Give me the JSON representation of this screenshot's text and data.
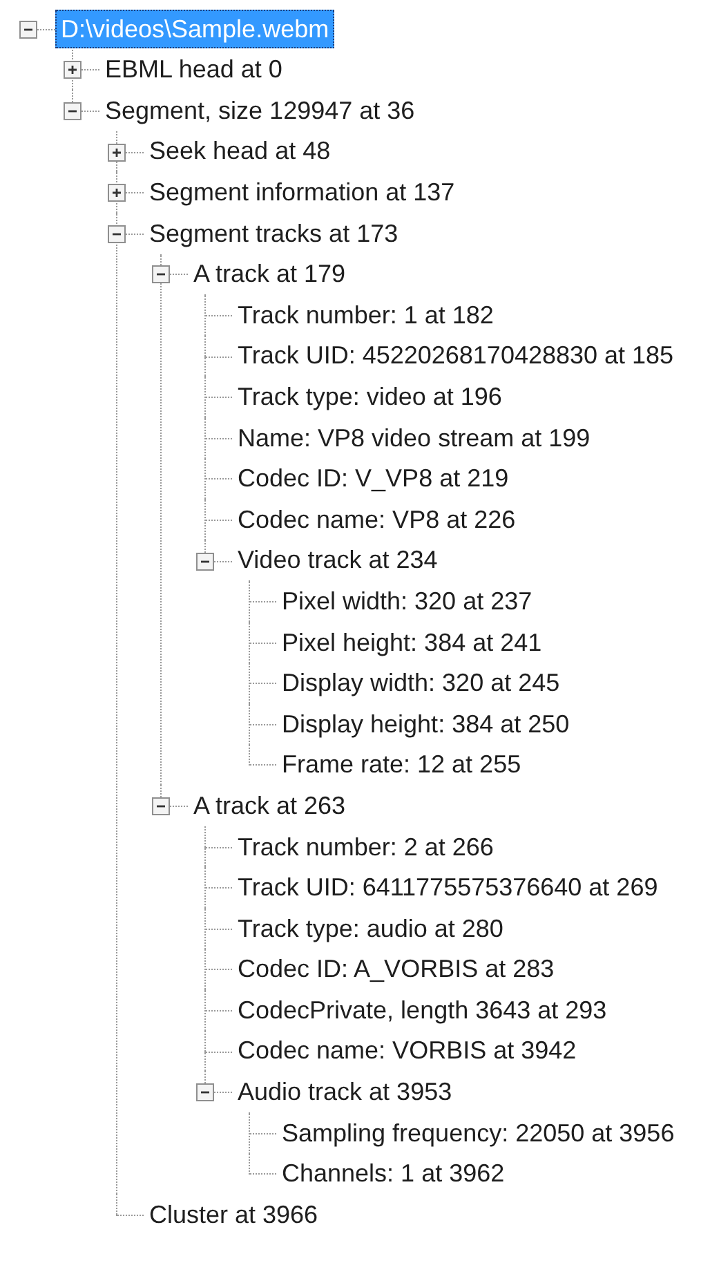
{
  "tree": [
    {
      "label": "D:\\videos\\Sample.webm",
      "selected": true,
      "expanded": true,
      "children": [
        {
          "label": "EBML head at 0",
          "selected": false,
          "expanded": false
        },
        {
          "label": "Segment, size 129947 at 36",
          "selected": false,
          "expanded": true,
          "children": [
            {
              "label": "Seek head at 48",
              "selected": false,
              "expanded": false
            },
            {
              "label": "Segment information at 137",
              "selected": false,
              "expanded": false
            },
            {
              "label": "Segment tracks at 173",
              "selected": false,
              "expanded": true,
              "children": [
                {
                  "label": "A track at 179",
                  "selected": false,
                  "expanded": true,
                  "children": [
                    {
                      "label": "Track number: 1 at 182",
                      "selected": false
                    },
                    {
                      "label": "Track UID: 45220268170428830 at 185",
                      "selected": false
                    },
                    {
                      "label": "Track type: video at 196",
                      "selected": false
                    },
                    {
                      "label": "Name: VP8 video stream at 199",
                      "selected": false
                    },
                    {
                      "label": "Codec ID: V_VP8 at 219",
                      "selected": false
                    },
                    {
                      "label": "Codec name: VP8 at 226",
                      "selected": false
                    },
                    {
                      "label": "Video track at 234",
                      "selected": false,
                      "expanded": true,
                      "children": [
                        {
                          "label": "Pixel width: 320 at 237",
                          "selected": false
                        },
                        {
                          "label": "Pixel height: 384 at 241",
                          "selected": false
                        },
                        {
                          "label": "Display width: 320 at 245",
                          "selected": false
                        },
                        {
                          "label": "Display height: 384 at 250",
                          "selected": false
                        },
                        {
                          "label": "Frame rate: 12 at 255",
                          "selected": false
                        }
                      ]
                    }
                  ]
                },
                {
                  "label": "A track at 263",
                  "selected": false,
                  "expanded": true,
                  "children": [
                    {
                      "label": "Track number: 2 at 266",
                      "selected": false
                    },
                    {
                      "label": "Track UID: 6411775575376640 at 269",
                      "selected": false
                    },
                    {
                      "label": "Track type: audio at 280",
                      "selected": false
                    },
                    {
                      "label": "Codec ID: A_VORBIS at 283",
                      "selected": false
                    },
                    {
                      "label": "CodecPrivate, length 3643 at 293",
                      "selected": false
                    },
                    {
                      "label": "Codec name: VORBIS at 3942",
                      "selected": false
                    },
                    {
                      "label": "Audio track at 3953",
                      "selected": false,
                      "expanded": true,
                      "children": [
                        {
                          "label": "Sampling frequency: 22050 at 3956",
                          "selected": false
                        },
                        {
                          "label": "Channels: 1 at 3962",
                          "selected": false
                        }
                      ]
                    }
                  ]
                }
              ]
            },
            {
              "label": "Cluster at 3966",
              "selected": false
            }
          ]
        }
      ]
    }
  ]
}
